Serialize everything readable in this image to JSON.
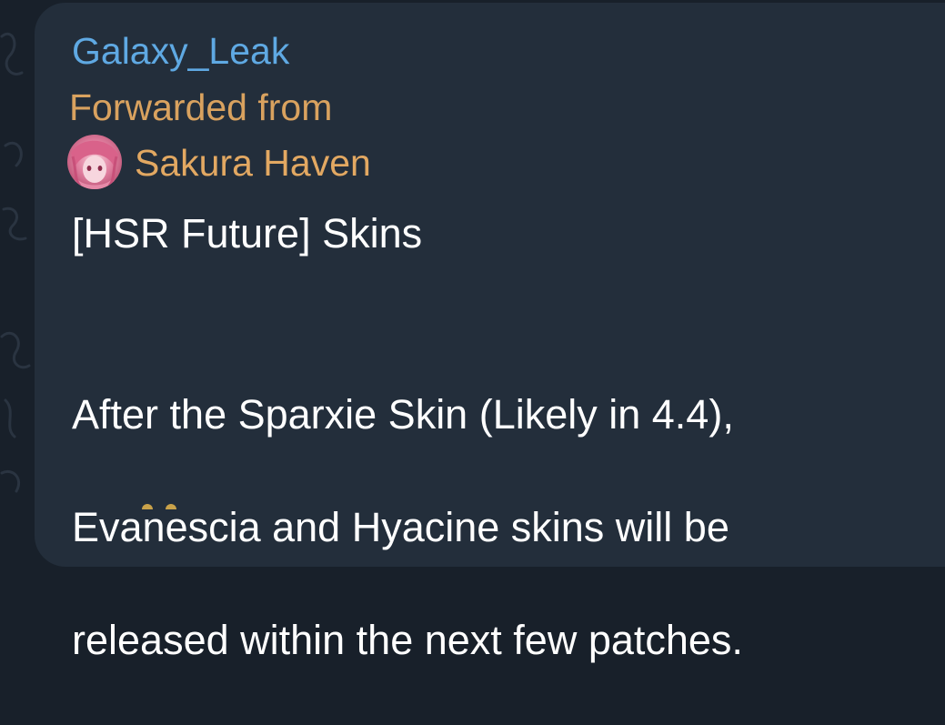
{
  "message": {
    "sender_name": "Galaxy_Leak",
    "forwarded_label": "Forwarded from",
    "forwarded_from": "Sakura Haven",
    "avatar_icon": "pink-haired-avatar",
    "title": "[HSR Future] Skins",
    "body_lines": [
      "After the Sparxie Skin (Likely in 4.4),",
      "Evanescia and Hyacine skins will be",
      "released within the next few patches."
    ]
  },
  "colors": {
    "background": "#18202a",
    "bubble": "#232e3b",
    "sender": "#5fa9e3",
    "forwarded": "#d9a25f",
    "text": "#ffffff"
  }
}
